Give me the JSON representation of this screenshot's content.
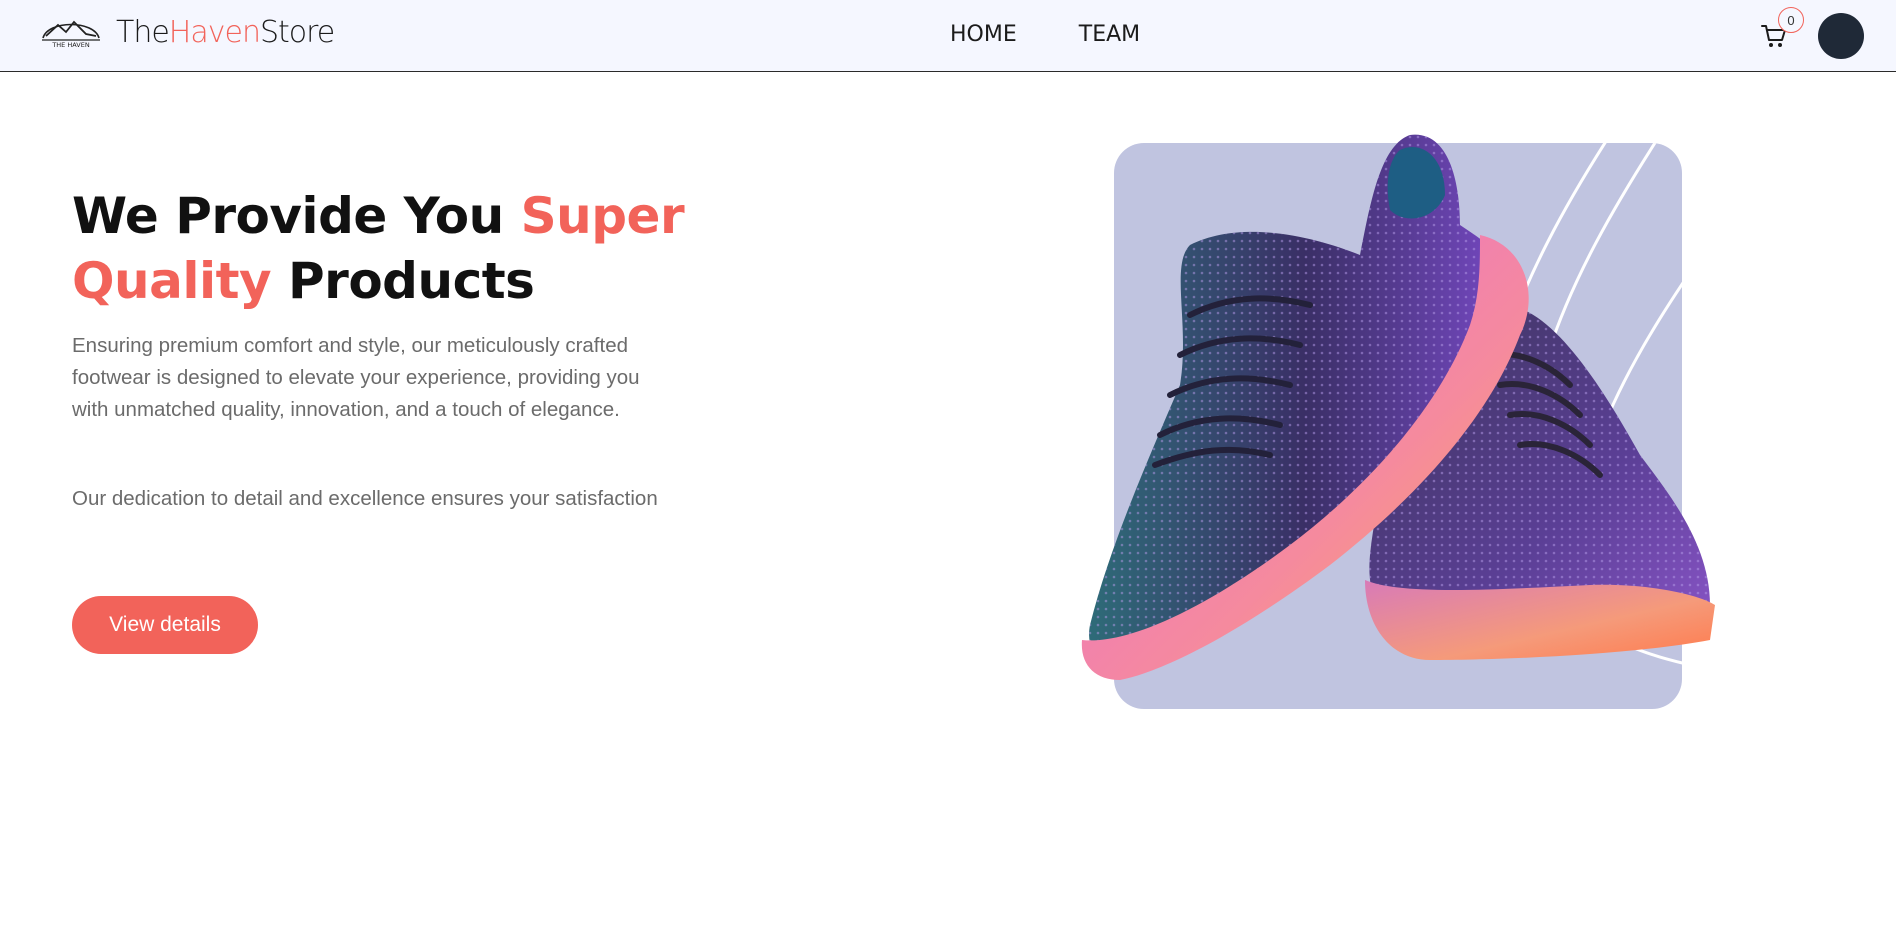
{
  "brand": {
    "part1": "The",
    "part2": "Haven",
    "part3": "Store",
    "mark_caption": "THE HAVEN",
    "accent_color": "#f2635a"
  },
  "nav": {
    "items": [
      {
        "label": "HOME"
      },
      {
        "label": "TEAM"
      }
    ]
  },
  "cart": {
    "icon": "shopping-cart-icon",
    "count": "0"
  },
  "hero": {
    "heading_part1": "We Provide You ",
    "heading_accent1": "Super",
    "heading_accent2": "Quality",
    "heading_part2": " Products",
    "paragraph1": "Ensuring premium comfort and style, our meticulously crafted footwear is designed to elevate your experience, providing you with unmatched quality, innovation, and a touch of elegance.",
    "paragraph2": "Our dedication to detail and excellence ensures your satisfaction",
    "cta_label": "View details"
  },
  "colors": {
    "navbar_bg": "#f5f7ff",
    "avatar": "#1f2937",
    "image_panel": "#c0c4e0"
  }
}
